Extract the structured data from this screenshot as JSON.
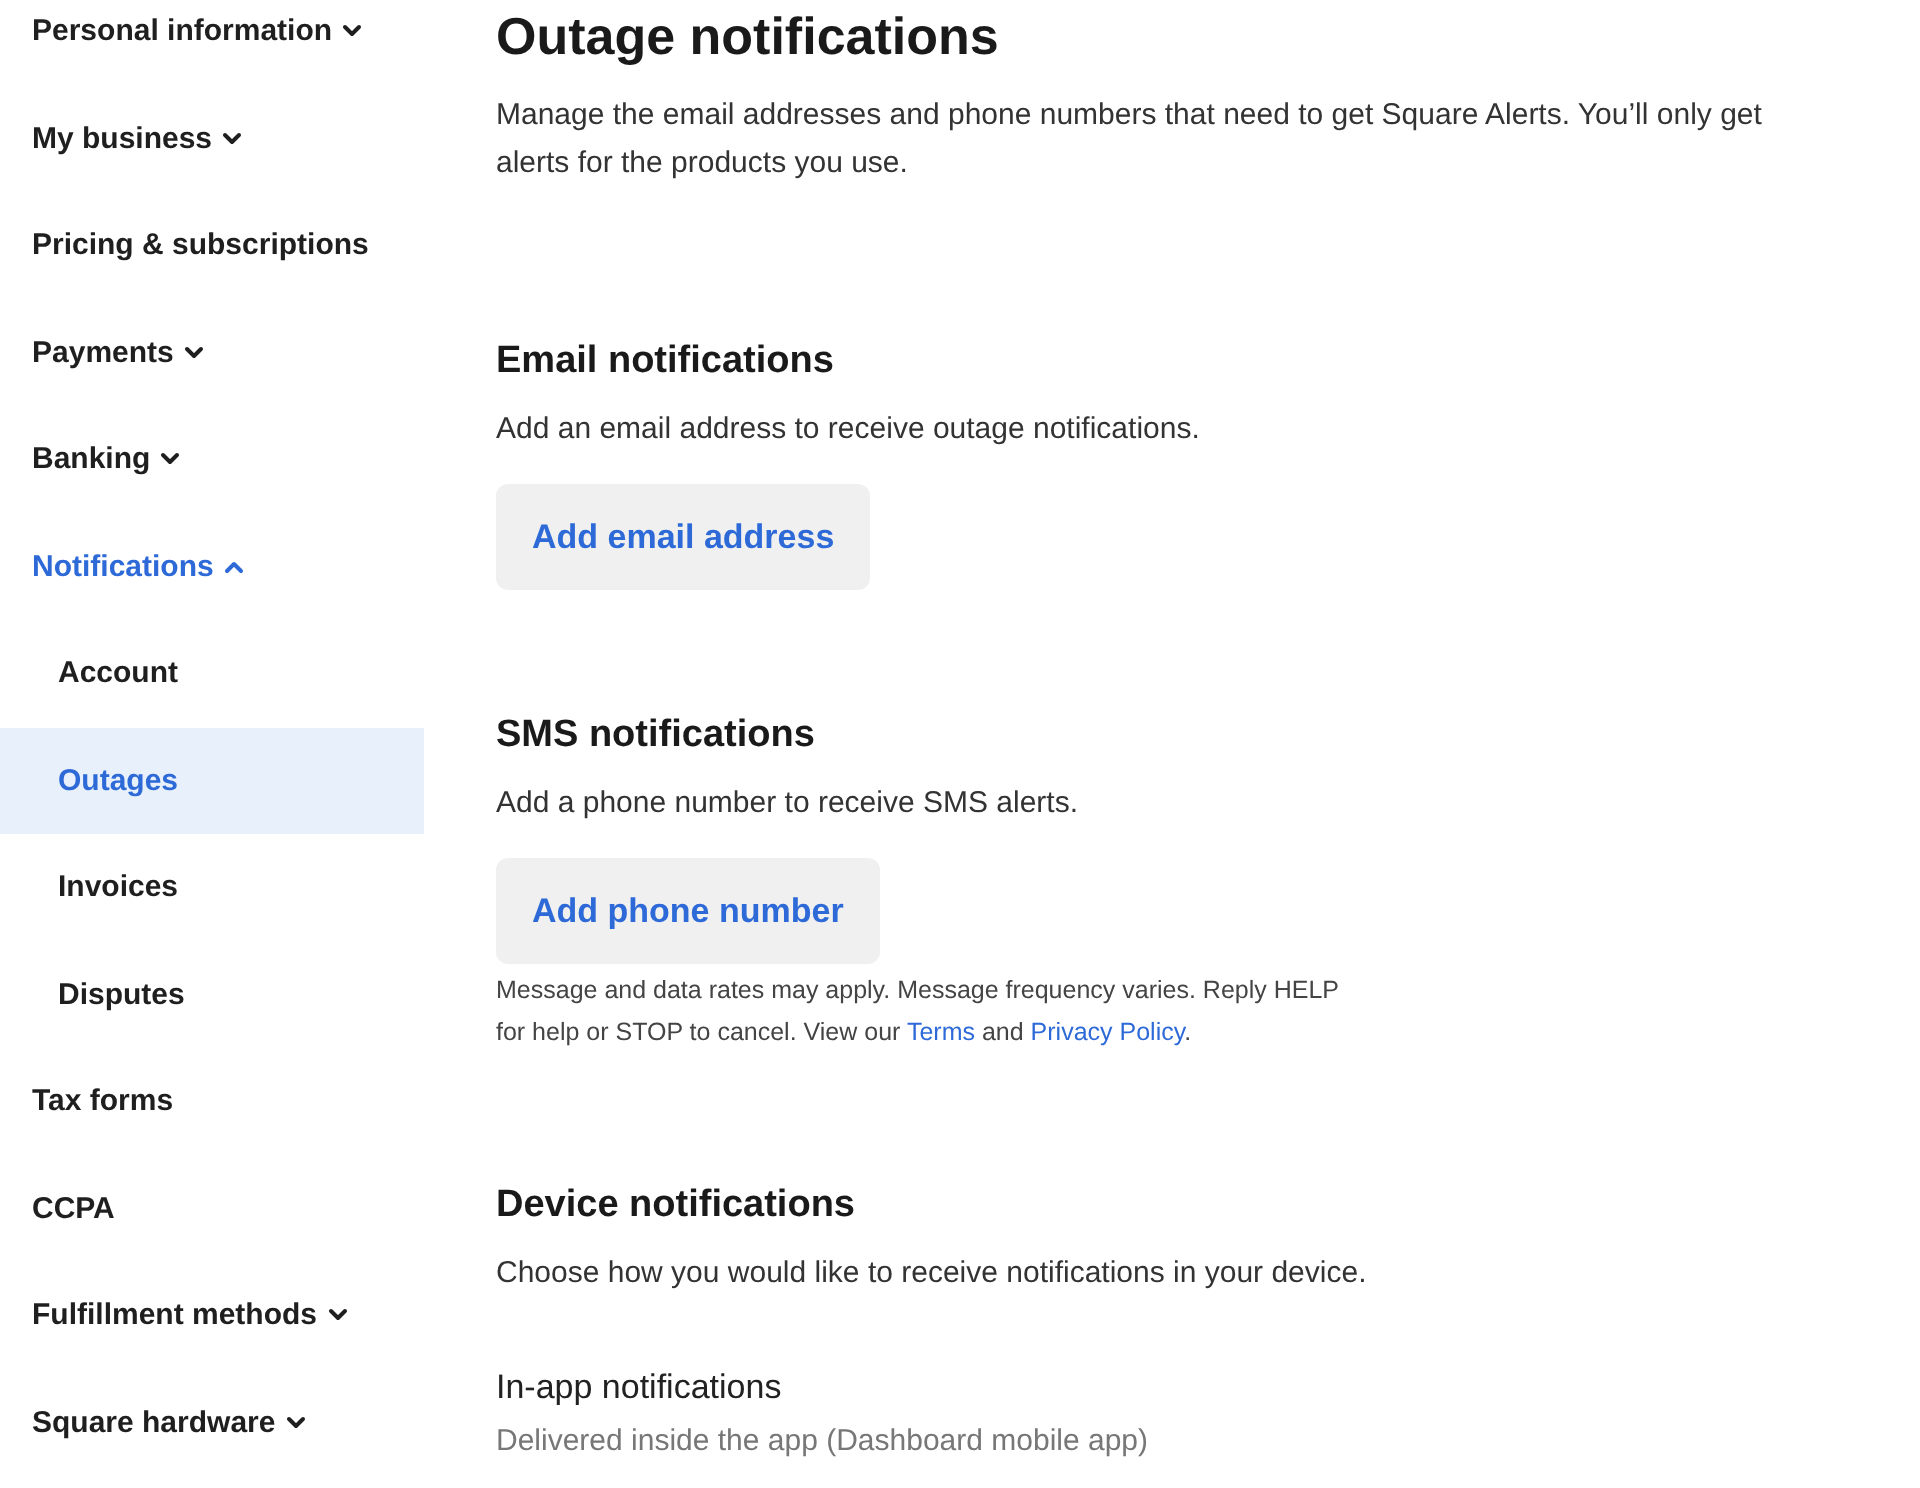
{
  "sidebar": {
    "items": [
      {
        "label": "Personal information",
        "kind": "menu",
        "expanded": false,
        "selected": false
      },
      {
        "label": "My business",
        "kind": "menu",
        "expanded": false,
        "selected": false
      },
      {
        "label": "Pricing & subscriptions",
        "kind": "plain",
        "selected": false
      },
      {
        "label": "Payments",
        "kind": "menu",
        "expanded": false,
        "selected": false
      },
      {
        "label": "Banking",
        "kind": "menu",
        "expanded": false,
        "selected": false
      },
      {
        "label": "Notifications",
        "kind": "menu",
        "expanded": true,
        "selected": true,
        "children": [
          {
            "label": "Account",
            "selected": false
          },
          {
            "label": "Outages",
            "selected": true
          },
          {
            "label": "Invoices",
            "selected": false
          },
          {
            "label": "Disputes",
            "selected": false
          }
        ]
      },
      {
        "label": "Tax forms",
        "kind": "plain",
        "selected": false
      },
      {
        "label": "CCPA",
        "kind": "plain",
        "selected": false
      },
      {
        "label": "Fulfillment methods",
        "kind": "menu",
        "expanded": false,
        "selected": false
      },
      {
        "label": "Square hardware",
        "kind": "menu",
        "expanded": false,
        "selected": false
      }
    ]
  },
  "page": {
    "title": "Outage notifications",
    "description": "Manage the email addresses and phone numbers that need to get Square Alerts. You’ll only get alerts for the products you use."
  },
  "sections": [
    {
      "heading": "Email notifications",
      "description": "Add an email address to receive outage notifications.",
      "button": "Add email address"
    },
    {
      "heading": "SMS notifications",
      "description": "Add a phone number to receive SMS alerts.",
      "button": "Add phone number",
      "disclaimer": [
        {
          "kind": "text",
          "text": "Message and data rates may apply. Message frequency varies. Reply HELP for help or STOP to cancel. View our "
        },
        {
          "kind": "link",
          "text": "Terms"
        },
        {
          "kind": "text",
          "text": " and "
        },
        {
          "kind": "link",
          "text": "Privacy Policy"
        },
        {
          "kind": "text",
          "text": "."
        }
      ]
    },
    {
      "heading": "Device notifications",
      "description": "Choose how you would like to receive notifications in your device.",
      "subsection": {
        "title": "In-app notifications",
        "description": "Delivered inside the app (Dashboard mobile app)"
      }
    }
  ]
}
